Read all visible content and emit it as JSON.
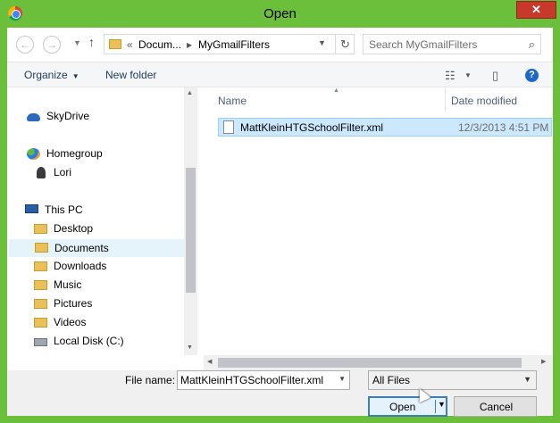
{
  "window": {
    "title": "Open",
    "close_label": "✕"
  },
  "navbar": {
    "back_icon": "back-arrow-icon",
    "forward_icon": "forward-arrow-icon",
    "up_icon": "up-arrow-icon",
    "breadcrumb_prefix": "«",
    "breadcrumb": [
      "Docum...",
      "MyGmailFilters"
    ],
    "search_placeholder": "Search MyGmailFilters"
  },
  "commandbar": {
    "organize": "Organize",
    "new_folder": "New folder"
  },
  "nav_pane": {
    "items": [
      {
        "label": "SkyDrive",
        "icon": "skydrive-cloud-icon"
      },
      {
        "label": "Homegroup",
        "icon": "homegroup-icon"
      },
      {
        "label": "Lori",
        "icon": "user-icon"
      },
      {
        "label": "This PC",
        "icon": "computer-icon"
      },
      {
        "label": "Desktop",
        "icon": "folder-icon"
      },
      {
        "label": "Documents",
        "icon": "folder-icon",
        "selected": true
      },
      {
        "label": "Downloads",
        "icon": "folder-icon"
      },
      {
        "label": "Music",
        "icon": "folder-icon"
      },
      {
        "label": "Pictures",
        "icon": "folder-icon"
      },
      {
        "label": "Videos",
        "icon": "folder-icon"
      },
      {
        "label": "Local Disk (C:)",
        "icon": "drive-icon"
      }
    ]
  },
  "file_list": {
    "columns": [
      "Name",
      "Date modified"
    ],
    "rows": [
      {
        "name": "MattKleinHTGSchoolFilter.xml",
        "date": "12/3/2013 4:51 PM",
        "selected": true
      }
    ]
  },
  "bottom": {
    "file_name_label": "File name:",
    "file_name_value": "MattKleinHTGSchoolFilter.xml",
    "filter_value": "All Files",
    "open_label": "Open",
    "cancel_label": "Cancel"
  },
  "colors": {
    "frame": "#6bbf3a",
    "close": "#c7392b",
    "selection": "#cce8ff"
  }
}
